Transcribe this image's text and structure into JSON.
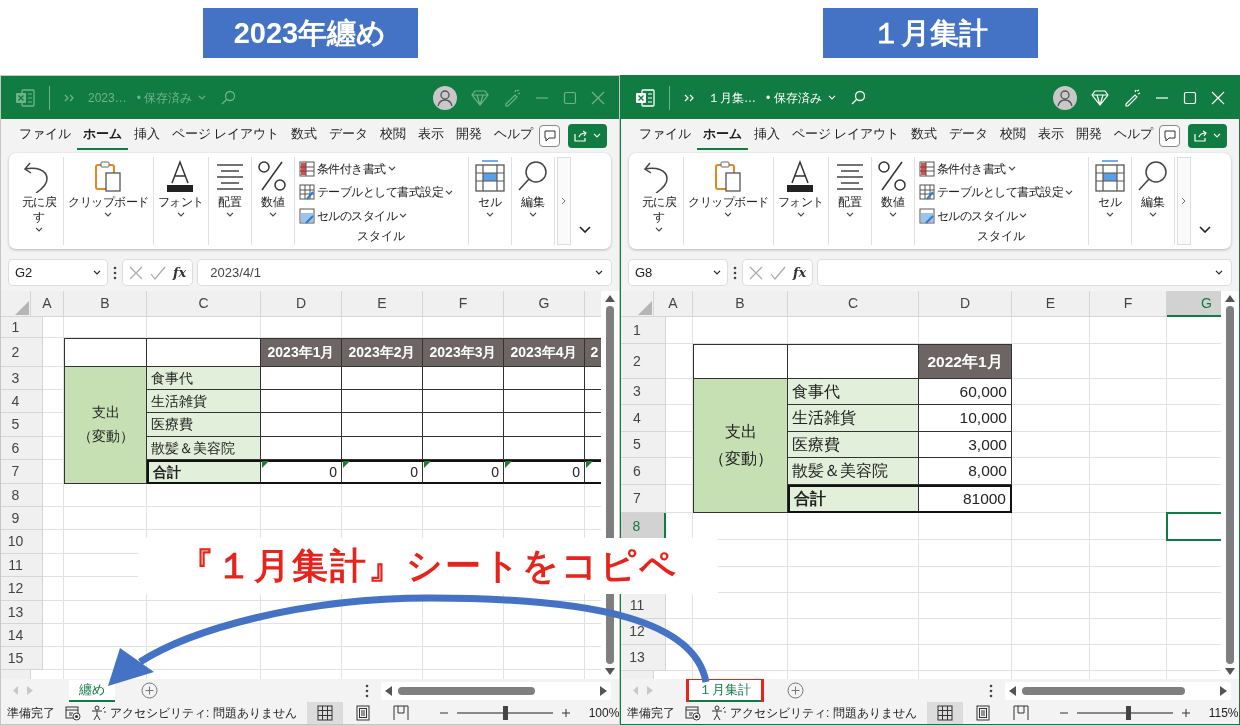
{
  "captions": [
    {
      "text": "2023年纏め"
    },
    {
      "text": "１月集計"
    }
  ],
  "windows": [
    {
      "active": false,
      "title": "2023…",
      "save_status": "• 保存済み",
      "menu_tabs": [
        {
          "label": "ファイル",
          "selected": false
        },
        {
          "label": "ホーム",
          "selected": true
        },
        {
          "label": "挿入",
          "selected": false
        },
        {
          "label": "ページ レイアウト",
          "selected": false
        },
        {
          "label": "数式",
          "selected": false
        },
        {
          "label": "データ",
          "selected": false
        },
        {
          "label": "校閲",
          "selected": false
        },
        {
          "label": "表示",
          "selected": false
        },
        {
          "label": "開発",
          "selected": false
        },
        {
          "label": "ヘルプ",
          "selected": false
        }
      ],
      "ribbon": [
        {
          "kind": "undo",
          "label": "元に戻す"
        },
        {
          "kind": "clipboard",
          "label": "クリップボード"
        },
        {
          "kind": "font",
          "label": "フォント"
        },
        {
          "kind": "align",
          "label": "配置"
        },
        {
          "kind": "number",
          "label": "数値"
        },
        {
          "kind": "styles",
          "items": [
            "条件付き書式",
            "テーブルとして書式設定",
            "セルのスタイル"
          ],
          "label": "スタイル"
        },
        {
          "kind": "cells",
          "label": "セル"
        },
        {
          "kind": "edit",
          "label": "編集"
        }
      ],
      "name_box": "G2",
      "fx": "fx",
      "formula": "2023/4/1",
      "columns": [
        {
          "label": "A",
          "selected": false
        },
        {
          "label": "B",
          "selected": false
        },
        {
          "label": "C",
          "selected": false
        },
        {
          "label": "D",
          "selected": false
        },
        {
          "label": "E",
          "selected": false
        },
        {
          "label": "F",
          "selected": false
        },
        {
          "label": "G",
          "selected": false
        }
      ],
      "rows": [
        {
          "label": "1",
          "selected": false
        },
        {
          "label": "2",
          "selected": false
        },
        {
          "label": "3",
          "selected": false
        },
        {
          "label": "4",
          "selected": false
        },
        {
          "label": "5",
          "selected": false
        },
        {
          "label": "6",
          "selected": false
        },
        {
          "label": "7",
          "selected": false
        },
        {
          "label": "8",
          "selected": false
        },
        {
          "label": "9",
          "selected": false
        },
        {
          "label": "10",
          "selected": false
        },
        {
          "label": "11",
          "selected": false
        },
        {
          "label": "12",
          "selected": false
        },
        {
          "label": "13",
          "selected": false
        },
        {
          "label": "14",
          "selected": false
        },
        {
          "label": "15",
          "selected": false
        },
        null
      ],
      "table": {
        "headers": [
          "2023年1月",
          "2023年2月",
          "2023年3月",
          "2023年4月",
          "2"
        ],
        "group": [
          "支出",
          "（変動）"
        ],
        "items": [
          {
            "label": "食事代"
          },
          {
            "label": "生活雑貨"
          },
          {
            "label": "医療費"
          },
          {
            "label": "散髪＆美容院"
          }
        ],
        "total": {
          "label": "合計",
          "values": [
            "0",
            "0",
            "0",
            "0"
          ],
          "flagged": true
        }
      },
      "sheet_tabs": [
        {
          "label": "纏め",
          "selected": true,
          "highlighted": false
        }
      ],
      "status": "準備完了",
      "accessibility": "アクセシビリティ: 問題ありません",
      "views": [
        {
          "kind": "normal",
          "selected": true
        },
        {
          "kind": "page_layout",
          "selected": false
        },
        {
          "kind": "page_break",
          "selected": false
        }
      ],
      "zoom": {
        "level": 0.5,
        "reading": "100%"
      }
    },
    {
      "active": true,
      "title": "１月集…",
      "save_status": "• 保存済み",
      "menu_tabs": [
        {
          "label": "ファイル",
          "selected": false
        },
        {
          "label": "ホーム",
          "selected": true
        },
        {
          "label": "挿入",
          "selected": false
        },
        {
          "label": "ページ レイアウト",
          "selected": false
        },
        {
          "label": "数式",
          "selected": false
        },
        {
          "label": "データ",
          "selected": false
        },
        {
          "label": "校閲",
          "selected": false
        },
        {
          "label": "表示",
          "selected": false
        },
        {
          "label": "開発",
          "selected": false
        },
        {
          "label": "ヘルプ",
          "selected": false
        }
      ],
      "ribbon": [
        {
          "kind": "undo",
          "label": "元に戻す"
        },
        {
          "kind": "clipboard",
          "label": "クリップボード"
        },
        {
          "kind": "font",
          "label": "フォント"
        },
        {
          "kind": "align",
          "label": "配置"
        },
        {
          "kind": "number",
          "label": "数値"
        },
        {
          "kind": "styles",
          "items": [
            "条件付き書式",
            "テーブルとして書式設定",
            "セルのスタイル"
          ],
          "label": "スタイル"
        },
        {
          "kind": "cells",
          "label": "セル"
        },
        {
          "kind": "edit",
          "label": "編集"
        }
      ],
      "name_box": "G8",
      "fx": "fx",
      "columns": [
        {
          "label": "A",
          "selected": false
        },
        {
          "label": "B",
          "selected": false
        },
        {
          "label": "C",
          "selected": false
        },
        {
          "label": "D",
          "selected": false
        },
        {
          "label": "E",
          "selected": false
        },
        {
          "label": "F",
          "selected": false
        },
        {
          "label": "G",
          "selected": true
        }
      ],
      "rows": [
        {
          "label": "1",
          "selected": false
        },
        {
          "label": "2",
          "selected": false
        },
        {
          "label": "3",
          "selected": false
        },
        {
          "label": "4",
          "selected": false
        },
        {
          "label": "5",
          "selected": false
        },
        {
          "label": "6",
          "selected": false
        },
        {
          "label": "7",
          "selected": false
        },
        {
          "label": "8",
          "selected": true
        },
        null,
        null,
        {
          "label": "11",
          "selected": false
        },
        {
          "label": "12",
          "selected": false
        },
        {
          "label": "13",
          "selected": false
        },
        null
      ],
      "table": {
        "headers": [
          "2022年1月"
        ],
        "group": [
          "支出",
          "（変動）"
        ],
        "items": [
          {
            "label": "食事代",
            "values": [
              "60,000"
            ]
          },
          {
            "label": "生活雑貨",
            "values": [
              "10,000"
            ]
          },
          {
            "label": "医療費",
            "values": [
              "3,000"
            ]
          },
          {
            "label": "散髪＆美容院",
            "values": [
              "8,000"
            ]
          }
        ],
        "total": {
          "label": "合計",
          "values": [
            "81000"
          ],
          "flagged": false
        }
      },
      "sheet_tabs": [
        {
          "label": "１月集計",
          "selected": true,
          "highlighted": true
        }
      ],
      "status": "準備完了",
      "accessibility": "アクセシビリティ: 問題ありません",
      "views": [
        {
          "kind": "normal",
          "selected": true
        },
        {
          "kind": "page_layout",
          "selected": false
        },
        {
          "kind": "page_break",
          "selected": false
        }
      ],
      "zoom": {
        "level": 0.53,
        "reading": "115%"
      }
    }
  ],
  "annotation": {
    "text": "『１月集計』シートをコピペ"
  }
}
